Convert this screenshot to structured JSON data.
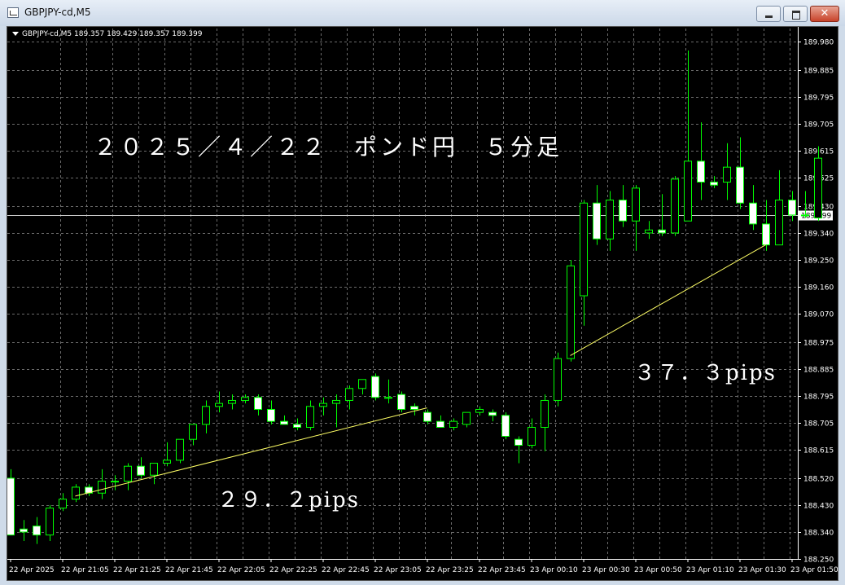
{
  "window": {
    "title": "GBPJPY-cd,M5",
    "close_symbol": "✕"
  },
  "chart": {
    "header": "GBPJPY-cd,M5  189.357 189.429 189.357 189.399",
    "title_annotation": "２０２５／４／２２　ポンド円　５分足",
    "pips_annotation_1": "２９．２pips",
    "pips_annotation_2": "３７．３pips",
    "current_price_label": "189.399"
  },
  "colors": {
    "background": "#000000",
    "bull_fill": "#000000",
    "bear_fill": "#ffffff",
    "wick": "#00ff00",
    "trendline": "#ffff66",
    "grid": "#6b6b6b",
    "bid_line": "#c8c8c8"
  },
  "chart_data": {
    "type": "candlestick",
    "symbol": "GBPJPY-cd",
    "timeframe": "M5",
    "ylim": [
      188.25,
      189.98
    ],
    "y_ticks": [
      "189.980",
      "189.885",
      "189.795",
      "189.705",
      "189.615",
      "189.525",
      "189.430",
      "189.340",
      "189.250",
      "189.160",
      "189.070",
      "188.975",
      "188.885",
      "188.795",
      "188.705",
      "188.615",
      "188.520",
      "188.430",
      "188.340",
      "188.250"
    ],
    "x_ticks": [
      "22 Apr 2025",
      "22 Apr 21:05",
      "22 Apr 21:25",
      "22 Apr 21:45",
      "22 Apr 22:05",
      "22 Apr 22:25",
      "22 Apr 22:45",
      "22 Apr 23:05",
      "22 Apr 23:25",
      "22 Apr 23:45",
      "23 Apr 00:10",
      "23 Apr 00:30",
      "23 Apr 00:50",
      "23 Apr 01:10",
      "23 Apr 01:30",
      "23 Apr 01:50"
    ],
    "current_price": 189.399,
    "candles": [
      {
        "o": 188.52,
        "h": 188.55,
        "l": 188.33,
        "c": 188.33
      },
      {
        "o": 188.35,
        "h": 188.38,
        "l": 188.31,
        "c": 188.34
      },
      {
        "o": 188.36,
        "h": 188.39,
        "l": 188.3,
        "c": 188.33
      },
      {
        "o": 188.33,
        "h": 188.43,
        "l": 188.31,
        "c": 188.42
      },
      {
        "o": 188.42,
        "h": 188.47,
        "l": 188.41,
        "c": 188.45
      },
      {
        "o": 188.45,
        "h": 188.5,
        "l": 188.44,
        "c": 188.49
      },
      {
        "o": 188.49,
        "h": 188.5,
        "l": 188.46,
        "c": 188.47
      },
      {
        "o": 188.47,
        "h": 188.55,
        "l": 188.45,
        "c": 188.51
      },
      {
        "o": 188.51,
        "h": 188.53,
        "l": 188.48,
        "c": 188.51
      },
      {
        "o": 188.51,
        "h": 188.57,
        "l": 188.48,
        "c": 188.56
      },
      {
        "o": 188.56,
        "h": 188.59,
        "l": 188.52,
        "c": 188.53
      },
      {
        "o": 188.53,
        "h": 188.57,
        "l": 188.5,
        "c": 188.57
      },
      {
        "o": 188.57,
        "h": 188.64,
        "l": 188.56,
        "c": 188.58
      },
      {
        "o": 188.58,
        "h": 188.65,
        "l": 188.57,
        "c": 188.65
      },
      {
        "o": 188.65,
        "h": 188.7,
        "l": 188.63,
        "c": 188.7
      },
      {
        "o": 188.7,
        "h": 188.78,
        "l": 188.67,
        "c": 188.76
      },
      {
        "o": 188.76,
        "h": 188.81,
        "l": 188.74,
        "c": 188.77
      },
      {
        "o": 188.77,
        "h": 188.8,
        "l": 188.75,
        "c": 188.78
      },
      {
        "o": 188.78,
        "h": 188.8,
        "l": 188.77,
        "c": 188.79
      },
      {
        "o": 188.79,
        "h": 188.8,
        "l": 188.73,
        "c": 188.75
      },
      {
        "o": 188.75,
        "h": 188.78,
        "l": 188.7,
        "c": 188.71
      },
      {
        "o": 188.71,
        "h": 188.73,
        "l": 188.7,
        "c": 188.7
      },
      {
        "o": 188.7,
        "h": 188.72,
        "l": 188.68,
        "c": 188.69
      },
      {
        "o": 188.69,
        "h": 188.78,
        "l": 188.68,
        "c": 188.76
      },
      {
        "o": 188.76,
        "h": 188.79,
        "l": 188.73,
        "c": 188.77
      },
      {
        "o": 188.77,
        "h": 188.8,
        "l": 188.69,
        "c": 188.78
      },
      {
        "o": 188.78,
        "h": 188.83,
        "l": 188.75,
        "c": 188.82
      },
      {
        "o": 188.82,
        "h": 188.85,
        "l": 188.8,
        "c": 188.85
      },
      {
        "o": 188.86,
        "h": 188.87,
        "l": 188.78,
        "c": 188.79
      },
      {
        "o": 188.79,
        "h": 188.85,
        "l": 188.77,
        "c": 188.79
      },
      {
        "o": 188.8,
        "h": 188.81,
        "l": 188.74,
        "c": 188.75
      },
      {
        "o": 188.76,
        "h": 188.77,
        "l": 188.73,
        "c": 188.75
      },
      {
        "o": 188.74,
        "h": 188.75,
        "l": 188.7,
        "c": 188.71
      },
      {
        "o": 188.71,
        "h": 188.73,
        "l": 188.69,
        "c": 188.69
      },
      {
        "o": 188.69,
        "h": 188.72,
        "l": 188.68,
        "c": 188.71
      },
      {
        "o": 188.7,
        "h": 188.74,
        "l": 188.69,
        "c": 188.74
      },
      {
        "o": 188.74,
        "h": 188.76,
        "l": 188.73,
        "c": 188.75
      },
      {
        "o": 188.74,
        "h": 188.75,
        "l": 188.71,
        "c": 188.73
      },
      {
        "o": 188.73,
        "h": 188.74,
        "l": 188.65,
        "c": 188.66
      },
      {
        "o": 188.65,
        "h": 188.66,
        "l": 188.57,
        "c": 188.63
      },
      {
        "o": 188.63,
        "h": 188.72,
        "l": 188.62,
        "c": 188.69
      },
      {
        "o": 188.69,
        "h": 188.8,
        "l": 188.61,
        "c": 188.78
      },
      {
        "o": 188.78,
        "h": 188.94,
        "l": 188.76,
        "c": 188.92
      },
      {
        "o": 188.92,
        "h": 189.25,
        "l": 188.91,
        "c": 189.23
      },
      {
        "o": 189.13,
        "h": 189.45,
        "l": 189.03,
        "c": 189.44
      },
      {
        "o": 189.44,
        "h": 189.5,
        "l": 189.3,
        "c": 189.32
      },
      {
        "o": 189.32,
        "h": 189.48,
        "l": 189.28,
        "c": 189.45
      },
      {
        "o": 189.45,
        "h": 189.5,
        "l": 189.36,
        "c": 189.38
      },
      {
        "o": 189.38,
        "h": 189.5,
        "l": 189.28,
        "c": 189.49
      },
      {
        "o": 189.34,
        "h": 189.38,
        "l": 189.32,
        "c": 189.35
      },
      {
        "o": 189.35,
        "h": 189.47,
        "l": 189.33,
        "c": 189.34
      },
      {
        "o": 189.34,
        "h": 189.53,
        "l": 189.33,
        "c": 189.52
      },
      {
        "o": 189.38,
        "h": 189.95,
        "l": 189.38,
        "c": 189.58
      },
      {
        "o": 189.58,
        "h": 189.71,
        "l": 189.45,
        "c": 189.51
      },
      {
        "o": 189.51,
        "h": 189.53,
        "l": 189.49,
        "c": 189.5
      },
      {
        "o": 189.51,
        "h": 189.64,
        "l": 189.45,
        "c": 189.56
      },
      {
        "o": 189.56,
        "h": 189.66,
        "l": 189.42,
        "c": 189.44
      },
      {
        "o": 189.44,
        "h": 189.5,
        "l": 189.35,
        "c": 189.37
      },
      {
        "o": 189.37,
        "h": 189.45,
        "l": 189.28,
        "c": 189.3
      },
      {
        "o": 189.3,
        "h": 189.55,
        "l": 189.3,
        "c": 189.45
      },
      {
        "o": 189.45,
        "h": 189.48,
        "l": 189.38,
        "c": 189.4
      },
      {
        "o": 189.4,
        "h": 189.48,
        "l": 189.39,
        "c": 189.4
      },
      {
        "o": 189.39,
        "h": 189.63,
        "l": 189.38,
        "c": 189.59
      }
    ],
    "trendlines": [
      {
        "from": {
          "candle": 5,
          "price": 188.46
        },
        "to": {
          "candle": 32,
          "price": 188.755
        }
      },
      {
        "from": {
          "candle": 43,
          "price": 188.93
        },
        "to": {
          "candle": 58,
          "price": 189.3
        }
      }
    ]
  }
}
